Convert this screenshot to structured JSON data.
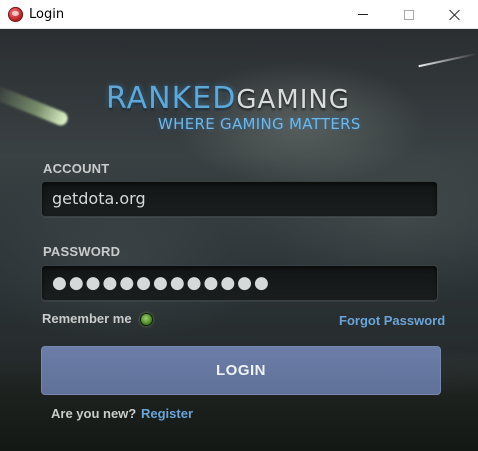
{
  "window": {
    "title": "Login",
    "icon": "app-logo-icon",
    "controls": [
      "minimize-icon",
      "maximize-icon",
      "close-icon"
    ]
  },
  "logo": {
    "ranked": "RANKED",
    "gaming": "GAMING",
    "tagline": "WHERE GAMING MATTERS"
  },
  "form": {
    "account_label": "ACCOUNT",
    "account_value": "getdota.org",
    "password_label": "PASSWORD",
    "password_masked": "●●●●●●●●●●●●●",
    "remember_label": "Remember me",
    "remember_checked": true,
    "forgot_label": "Forgot Password",
    "login_label": "LOGIN",
    "new_user_label": "Are you new?",
    "register_label": "Register"
  },
  "colors": {
    "brand_blue": "#5ea8d8",
    "link_blue": "#6aa4d8",
    "button_bg": "#6677a0",
    "toggle_green": "#6fb040"
  }
}
